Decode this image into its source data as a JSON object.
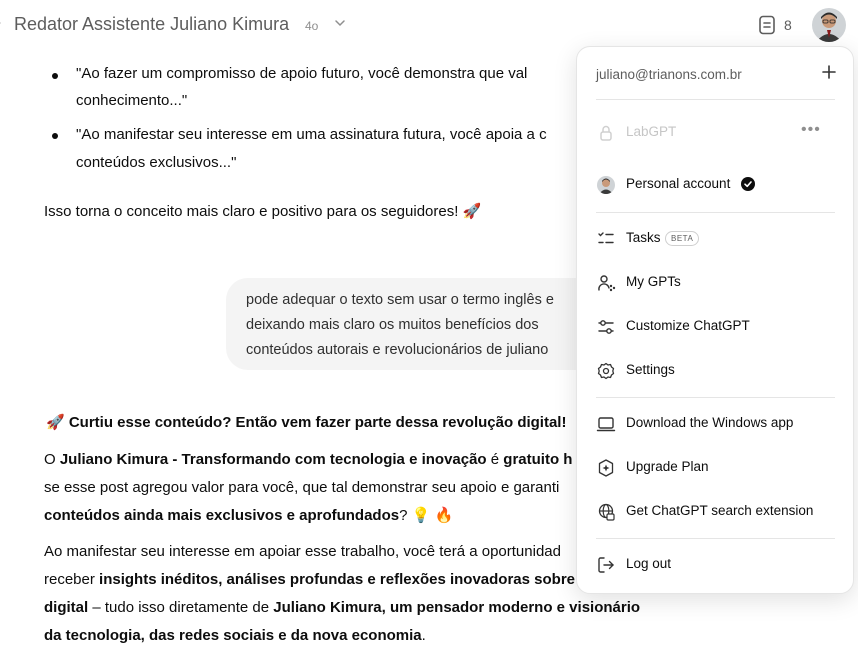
{
  "header": {
    "title": "Redator Assistente Juliano Kimura",
    "model": "4o",
    "doc_count": "8"
  },
  "chat": {
    "bullets": [
      [
        "\"Ao fazer um compromisso de apoio futuro, você demonstra que val",
        "conhecimento...\""
      ],
      [
        "\"Ao manifestar seu interesse em uma assinatura futura, você apoia a c",
        "conteúdos exclusivos...\""
      ]
    ],
    "summary": "Isso torna o conceito mais claro e positivo para os seguidores! 🚀",
    "user_message": [
      "pode adequar o texto sem usar o termo inglês e",
      "deixando mais claro os muitos benefícios dos",
      "conteúdos autorais e revolucionários de juliano"
    ],
    "reply": {
      "heading": "🚀 Curtiu esse conteúdo? Então vem fazer parte dessa revolução digital!",
      "p1_a": "O ",
      "p1_b": "Juliano Kimura - Transformando com tecnologia e inovação",
      "p1_c": " é ",
      "p1_d": "gratuito h",
      "p1_line2": "se esse post agregou valor para você, que tal demonstrar seu apoio e garanti",
      "p1_line3_b": "conteúdos ainda mais exclusivos e aprofundados",
      "p1_line3_c": "? 💡 🔥",
      "p2_line1": "Ao manifestar seu interesse em apoiar esse trabalho, você terá a oportunidad",
      "p2_line2_a": "receber ",
      "p2_line2_b": "insights inéditos, análises profundas e reflexões inovadoras sobre",
      "p2_line3_a": "digital",
      "p2_line3_b": " – tudo isso diretamente de ",
      "p2_line3_c": "Juliano Kimura, um pensador moderno e visionário",
      "p2_line4_a": "da tecnologia, das redes sociais e da nova economia",
      "p2_line4_b": "."
    }
  },
  "menu": {
    "email": "juliano@trianons.com.br",
    "workspace": "LabGPT",
    "personal": "Personal account",
    "items": {
      "tasks": "Tasks",
      "beta": "BETA",
      "my_gpts": "My GPTs",
      "customize": "Customize ChatGPT",
      "settings": "Settings",
      "download": "Download the Windows app",
      "upgrade": "Upgrade Plan",
      "extension": "Get ChatGPT search extension",
      "logout": "Log out"
    }
  }
}
